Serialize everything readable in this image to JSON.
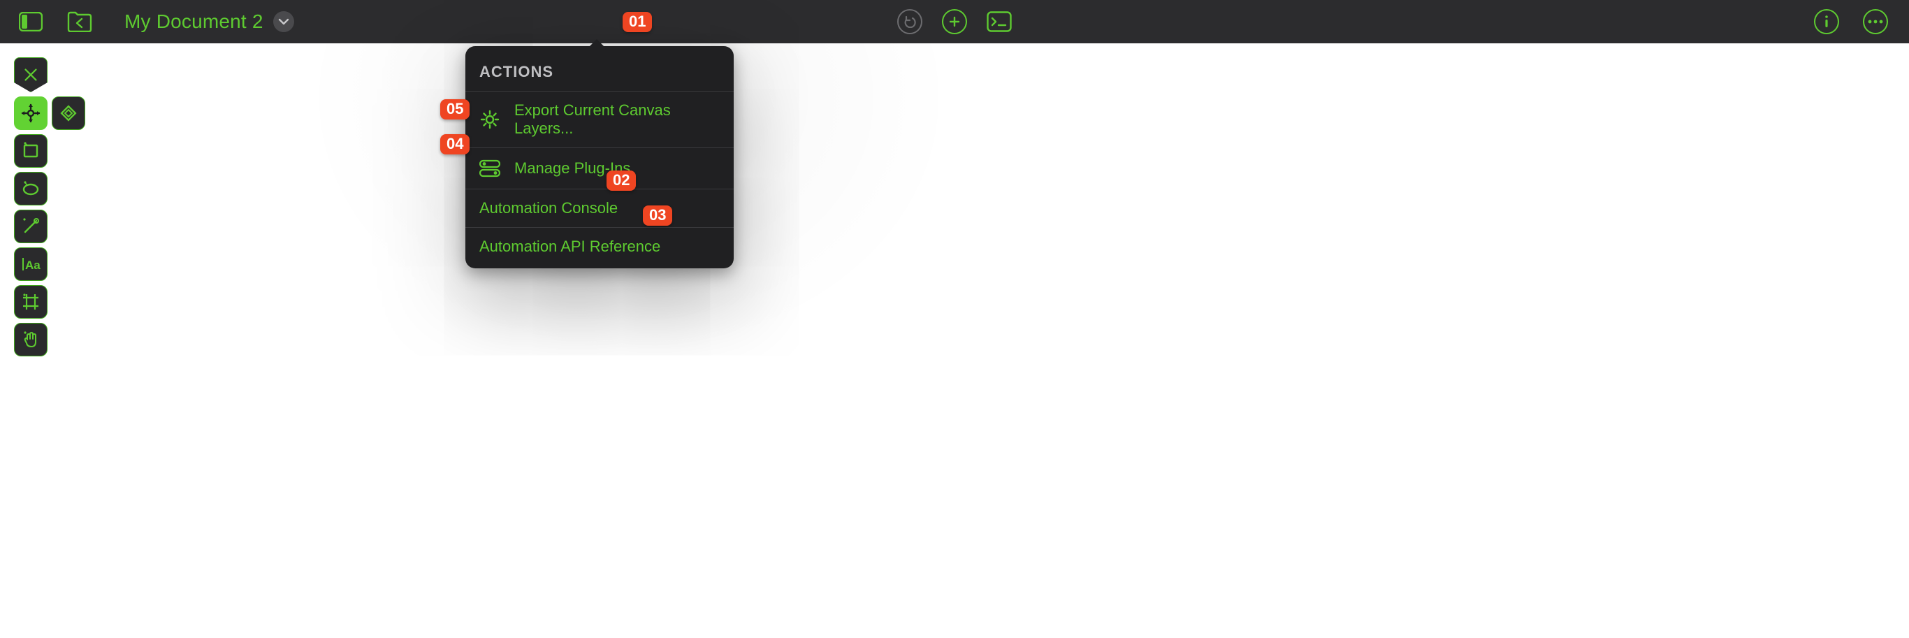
{
  "topbar": {
    "document_title": "My Document 2"
  },
  "popover": {
    "header": "ACTIONS",
    "items": [
      {
        "icon": "gear",
        "label": "Export Current Canvas Layers..."
      },
      {
        "icon": "toggle",
        "label": "Manage Plug-Ins"
      },
      {
        "icon": null,
        "label": "Automation Console"
      },
      {
        "icon": null,
        "label": "Automation API Reference"
      }
    ]
  },
  "badges": {
    "b01": "01",
    "b02": "02",
    "b03": "03",
    "b04": "04",
    "b05": "05"
  },
  "colors": {
    "accent_green": "#5ecb30",
    "badge_orange": "#ef4522",
    "panel_bg": "#202022",
    "topbar_bg": "#2c2c2e"
  },
  "toolbar_tools": [
    "pen",
    "move",
    "diamond",
    "rect",
    "ellipse",
    "line",
    "text",
    "artboard",
    "hand"
  ]
}
